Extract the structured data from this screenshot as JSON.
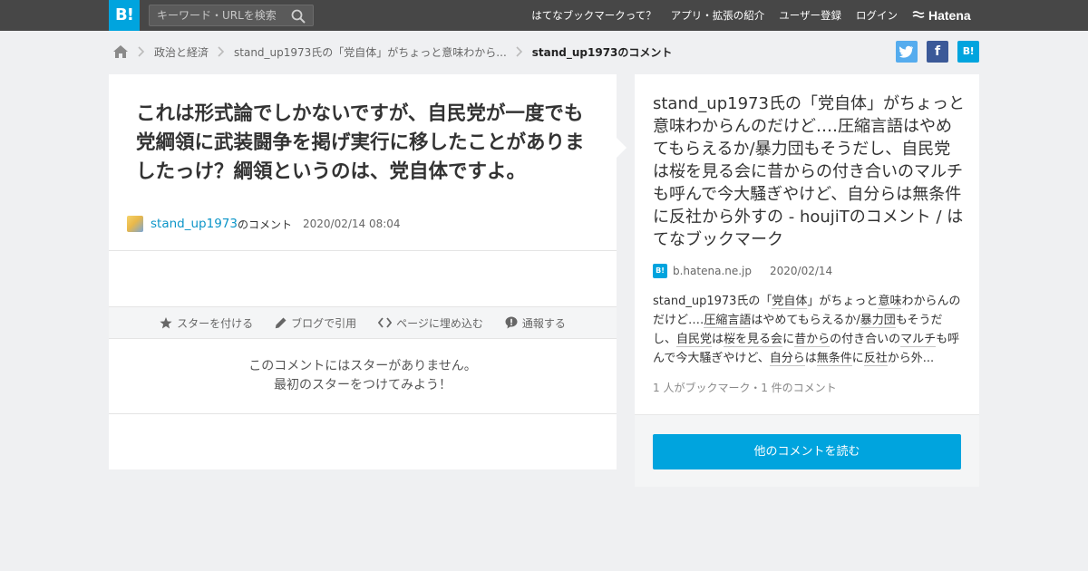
{
  "topbar": {
    "logo_text": "B!",
    "search_placeholder": "キーワード・URLを検索",
    "nav": [
      "はてなブックマークって？",
      "アプリ・拡張の紹介",
      "ユーザー登録",
      "ログイン"
    ],
    "hatena_label": "Hatena"
  },
  "breadcrumb": {
    "items": [
      "政治と経済",
      "stand_up1973氏の「党自体」がちょっと意味わから...",
      "stand_up1973のコメント"
    ]
  },
  "share": {
    "twitter_icon": "twitter-icon",
    "facebook_label": "f",
    "hatebu_label": "B!"
  },
  "comment": {
    "text": "これは形式論でしかないですが、自民党が一度でも党綱領に武装闘争を掲げ実行に移したことがありましたっけ？綱領というのは、党自体ですよ。",
    "username": "stand_up1973",
    "no_comment_suffix": "のコメント",
    "date": "2020/02/14 08:04"
  },
  "actions": {
    "star": "スターを付ける",
    "blog": "ブログで引用",
    "embed": "ページに埋め込む",
    "report": "通報する"
  },
  "stars": {
    "empty_line1": "このコメントにはスターがありません。",
    "empty_line2": "最初のスターをつけてみよう！"
  },
  "entry": {
    "title": "stand_up1973氏の「党自体」がちょっと意味わからんのだけど‥‥圧縮言語はやめてもらえるか/暴力団もそうだし、自民党は桜を見る会に昔からの付き合いのマルチも呼んで今大騒ぎやけど、自分らは無条件に反社から外すの - houjiTのコメント / はてなブックマーク",
    "favicon_text": "B!",
    "domain": "b.hatena.ne.jp",
    "date": "2020/02/14",
    "summary_parts": [
      {
        "t": "stand_up1973氏の「",
        "kw": false
      },
      {
        "t": "党自体",
        "kw": true
      },
      {
        "t": "」がちょっと",
        "kw": false
      },
      {
        "t": "意味",
        "kw": true
      },
      {
        "t": "わからんのだけど‥‥",
        "kw": false
      },
      {
        "t": "圧縮言語",
        "kw": true
      },
      {
        "t": "はやめてもらえるか/",
        "kw": false
      },
      {
        "t": "暴力団",
        "kw": true
      },
      {
        "t": "もそうだし、",
        "kw": false
      },
      {
        "t": "自民党",
        "kw": true
      },
      {
        "t": "は",
        "kw": false
      },
      {
        "t": "桜を見る会",
        "kw": true
      },
      {
        "t": "に",
        "kw": false
      },
      {
        "t": "昔から",
        "kw": true
      },
      {
        "t": "の付き合いの",
        "kw": false
      },
      {
        "t": "マルチ",
        "kw": true
      },
      {
        "t": "も呼んで今大騒ぎやけど、",
        "kw": false
      },
      {
        "t": "自分ら",
        "kw": true
      },
      {
        "t": "は",
        "kw": false
      },
      {
        "t": "無条件",
        "kw": true
      },
      {
        "t": "に",
        "kw": false
      },
      {
        "t": "反社",
        "kw": true
      },
      {
        "t": "から外...",
        "kw": false
      }
    ],
    "counts": "1 人がブックマーク・1 件のコメント",
    "read_button": "他のコメントを読む"
  }
}
